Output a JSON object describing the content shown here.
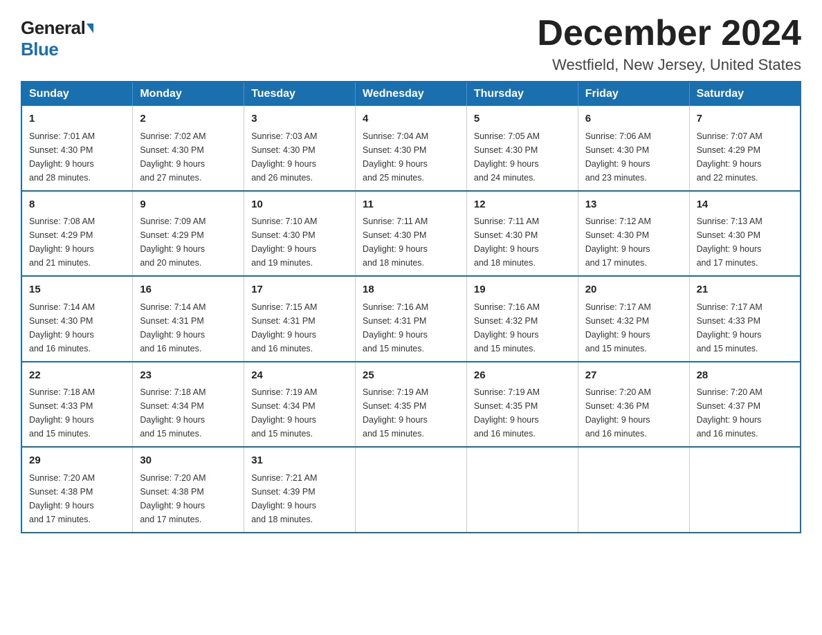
{
  "header": {
    "logo_general": "General",
    "logo_blue": "Blue",
    "month_title": "December 2024",
    "location": "Westfield, New Jersey, United States"
  },
  "days_of_week": [
    "Sunday",
    "Monday",
    "Tuesday",
    "Wednesday",
    "Thursday",
    "Friday",
    "Saturday"
  ],
  "weeks": [
    [
      {
        "day": "1",
        "sunrise": "7:01 AM",
        "sunset": "4:30 PM",
        "daylight": "9 hours and 28 minutes."
      },
      {
        "day": "2",
        "sunrise": "7:02 AM",
        "sunset": "4:30 PM",
        "daylight": "9 hours and 27 minutes."
      },
      {
        "day": "3",
        "sunrise": "7:03 AM",
        "sunset": "4:30 PM",
        "daylight": "9 hours and 26 minutes."
      },
      {
        "day": "4",
        "sunrise": "7:04 AM",
        "sunset": "4:30 PM",
        "daylight": "9 hours and 25 minutes."
      },
      {
        "day": "5",
        "sunrise": "7:05 AM",
        "sunset": "4:30 PM",
        "daylight": "9 hours and 24 minutes."
      },
      {
        "day": "6",
        "sunrise": "7:06 AM",
        "sunset": "4:30 PM",
        "daylight": "9 hours and 23 minutes."
      },
      {
        "day": "7",
        "sunrise": "7:07 AM",
        "sunset": "4:29 PM",
        "daylight": "9 hours and 22 minutes."
      }
    ],
    [
      {
        "day": "8",
        "sunrise": "7:08 AM",
        "sunset": "4:29 PM",
        "daylight": "9 hours and 21 minutes."
      },
      {
        "day": "9",
        "sunrise": "7:09 AM",
        "sunset": "4:29 PM",
        "daylight": "9 hours and 20 minutes."
      },
      {
        "day": "10",
        "sunrise": "7:10 AM",
        "sunset": "4:30 PM",
        "daylight": "9 hours and 19 minutes."
      },
      {
        "day": "11",
        "sunrise": "7:11 AM",
        "sunset": "4:30 PM",
        "daylight": "9 hours and 18 minutes."
      },
      {
        "day": "12",
        "sunrise": "7:11 AM",
        "sunset": "4:30 PM",
        "daylight": "9 hours and 18 minutes."
      },
      {
        "day": "13",
        "sunrise": "7:12 AM",
        "sunset": "4:30 PM",
        "daylight": "9 hours and 17 minutes."
      },
      {
        "day": "14",
        "sunrise": "7:13 AM",
        "sunset": "4:30 PM",
        "daylight": "9 hours and 17 minutes."
      }
    ],
    [
      {
        "day": "15",
        "sunrise": "7:14 AM",
        "sunset": "4:30 PM",
        "daylight": "9 hours and 16 minutes."
      },
      {
        "day": "16",
        "sunrise": "7:14 AM",
        "sunset": "4:31 PM",
        "daylight": "9 hours and 16 minutes."
      },
      {
        "day": "17",
        "sunrise": "7:15 AM",
        "sunset": "4:31 PM",
        "daylight": "9 hours and 16 minutes."
      },
      {
        "day": "18",
        "sunrise": "7:16 AM",
        "sunset": "4:31 PM",
        "daylight": "9 hours and 15 minutes."
      },
      {
        "day": "19",
        "sunrise": "7:16 AM",
        "sunset": "4:32 PM",
        "daylight": "9 hours and 15 minutes."
      },
      {
        "day": "20",
        "sunrise": "7:17 AM",
        "sunset": "4:32 PM",
        "daylight": "9 hours and 15 minutes."
      },
      {
        "day": "21",
        "sunrise": "7:17 AM",
        "sunset": "4:33 PM",
        "daylight": "9 hours and 15 minutes."
      }
    ],
    [
      {
        "day": "22",
        "sunrise": "7:18 AM",
        "sunset": "4:33 PM",
        "daylight": "9 hours and 15 minutes."
      },
      {
        "day": "23",
        "sunrise": "7:18 AM",
        "sunset": "4:34 PM",
        "daylight": "9 hours and 15 minutes."
      },
      {
        "day": "24",
        "sunrise": "7:19 AM",
        "sunset": "4:34 PM",
        "daylight": "9 hours and 15 minutes."
      },
      {
        "day": "25",
        "sunrise": "7:19 AM",
        "sunset": "4:35 PM",
        "daylight": "9 hours and 15 minutes."
      },
      {
        "day": "26",
        "sunrise": "7:19 AM",
        "sunset": "4:35 PM",
        "daylight": "9 hours and 16 minutes."
      },
      {
        "day": "27",
        "sunrise": "7:20 AM",
        "sunset": "4:36 PM",
        "daylight": "9 hours and 16 minutes."
      },
      {
        "day": "28",
        "sunrise": "7:20 AM",
        "sunset": "4:37 PM",
        "daylight": "9 hours and 16 minutes."
      }
    ],
    [
      {
        "day": "29",
        "sunrise": "7:20 AM",
        "sunset": "4:38 PM",
        "daylight": "9 hours and 17 minutes."
      },
      {
        "day": "30",
        "sunrise": "7:20 AM",
        "sunset": "4:38 PM",
        "daylight": "9 hours and 17 minutes."
      },
      {
        "day": "31",
        "sunrise": "7:21 AM",
        "sunset": "4:39 PM",
        "daylight": "9 hours and 18 minutes."
      },
      null,
      null,
      null,
      null
    ]
  ],
  "labels": {
    "sunrise": "Sunrise:",
    "sunset": "Sunset:",
    "daylight": "Daylight:"
  }
}
